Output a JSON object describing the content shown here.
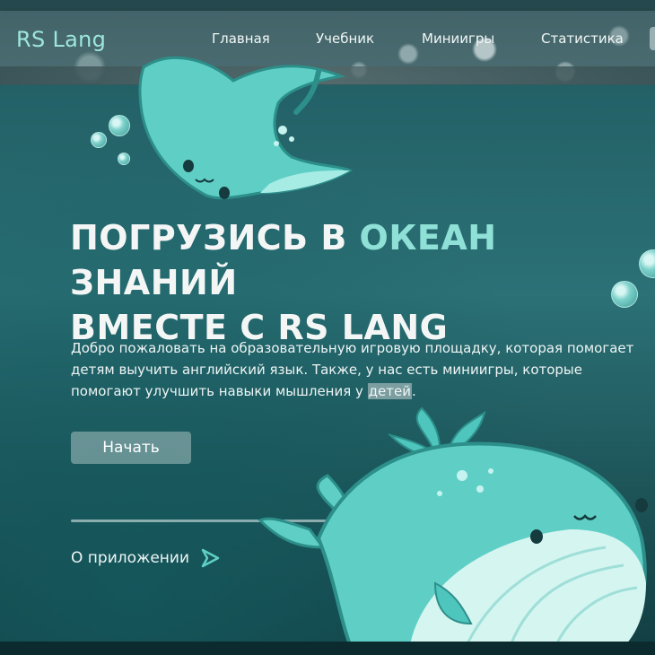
{
  "header": {
    "logo": "RS Lang",
    "nav": [
      "Главная",
      "Учебник",
      "Миниигры",
      "Статистика"
    ]
  },
  "hero": {
    "headline_part1": "ПОГРУЗИСЬ В ",
    "headline_accent": "ОКЕАН",
    "headline_part2": " ЗНАНИЙ",
    "headline_line2": "ВМЕСТЕ С RS LANG",
    "description_main": "Добро пожаловать на образовательную игровую площадку, которая помогает детям выучить английский язык. Также, у нас есть миниигры, которые помогают улучшить навыки мышления у ",
    "description_highlight": "детей",
    "description_end": ".",
    "start_button": "Начать",
    "about_link": "О приложении"
  },
  "icons": {
    "about_arrow": "play-arrow-icon",
    "mascots": [
      "stingray-illustration",
      "whale-illustration",
      "bubble-icon"
    ]
  },
  "colors": {
    "accent": "#8fe0d6",
    "background": "#2b7176",
    "mascot": "#5fcfc6"
  }
}
